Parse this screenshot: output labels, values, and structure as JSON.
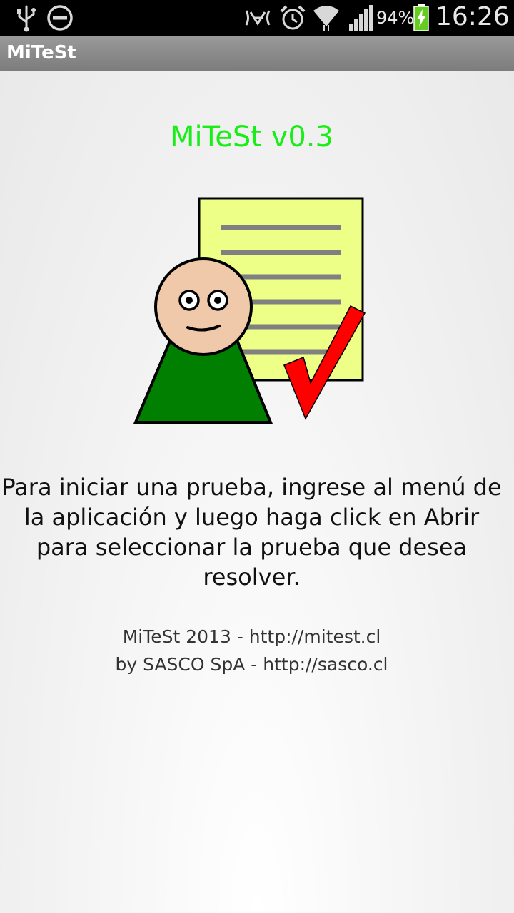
{
  "status_bar": {
    "icons_left": [
      "usb-icon",
      "do-not-disturb-icon"
    ],
    "icons_right": [
      "nfc-icon",
      "alarm-icon",
      "wifi-icon",
      "signal-icon",
      "battery-charging-icon"
    ],
    "battery_text": "94%",
    "battery_level": 0.94,
    "time": "16:26"
  },
  "action_bar": {
    "title": "MiTeSt"
  },
  "main": {
    "version_title": "MiTeSt v0.3",
    "instructions": "Para iniciar una prueba, ingrese al menú de la aplicación y luego haga click en Abrir para seleccionar la prueba que desea resolver.",
    "footer": {
      "line1": "MiTeSt 2013 - http://mitest.cl",
      "line2": "by SASCO SpA - http://sasco.cl"
    }
  },
  "colors": {
    "title_green": "#19ee19",
    "paper_yellow": "#eeff88",
    "shirt_green": "#007f00",
    "check_red": "#ff0000",
    "skin": "#f0c8aa"
  }
}
